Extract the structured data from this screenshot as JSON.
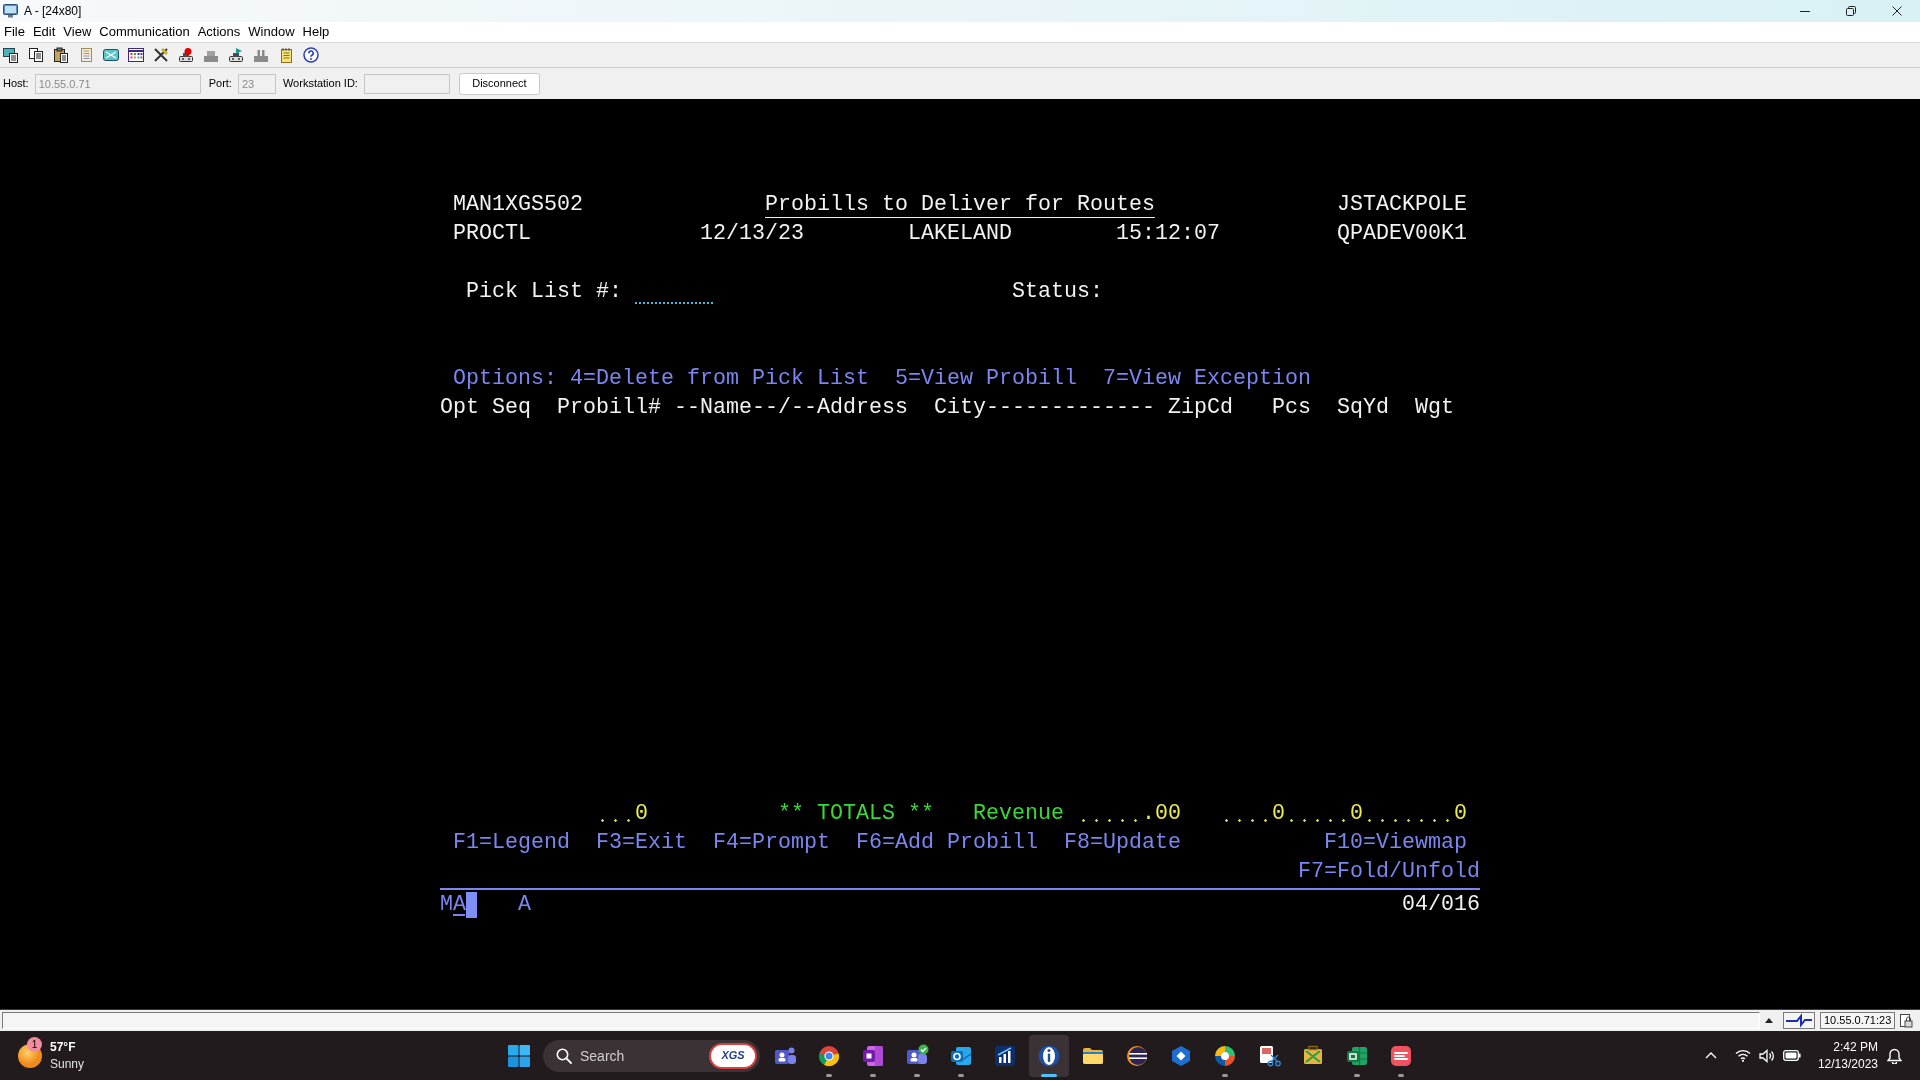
{
  "window": {
    "title": "A - [24x80]"
  },
  "menu": [
    "File",
    "Edit",
    "View",
    "Communication",
    "Actions",
    "Window",
    "Help"
  ],
  "connection": {
    "fields": [
      {
        "label": "Host:",
        "value": "10.55.0.71",
        "disabled": true
      },
      {
        "label": "Port:",
        "value": "23",
        "disabled": true
      },
      {
        "label": "Workstation ID:",
        "disabled": true
      }
    ],
    "button": "Disconnect"
  },
  "screen": {
    "header": {
      "program": "MAN1XGS502",
      "title": "Probills to Deliver for Routes",
      "user": "JSTACKPOLE"
    },
    "subheader": {
      "library": "PROCTL",
      "date": "12/13/23",
      "location": "LAKELAND",
      "time": "15:12:07",
      "device": "QPADEV00K1"
    },
    "pick_list": {
      "label": "Pick List #:"
    },
    "status": {
      "label": "Status:"
    },
    "options": {
      "label": "Options:",
      "items": [
        "4=Delete from Pick List",
        "5=View Probill",
        "7=View Exception"
      ]
    },
    "columns": [
      "Opt",
      "Seq",
      "Probill#",
      "--Name--/--Address",
      "City-------------",
      "ZipCd",
      "Pcs",
      "SqYd",
      "Wgt"
    ],
    "totals": {
      "count": "0",
      "label": "** TOTALS **",
      "revenue_label": "Revenue",
      "revenue": ".00",
      "pcs": "0",
      "sqyd": "0",
      "wgt": "0"
    },
    "function_keys": [
      "F1=Legend",
      "F3=Exit",
      "F4=Prompt",
      "F6=Add Probill",
      "F8=Update",
      "F10=Viewmap",
      "F7=Fold/Unfold"
    ]
  },
  "oia": {
    "indicator": "MA",
    "shift": "A",
    "cursor_position": "04/016"
  },
  "status_bar": {
    "address": "10.55.0.71:23"
  },
  "taskbar": {
    "weather": {
      "badge": "1",
      "temperature": "57°F",
      "condition": "Sunny"
    },
    "search": {
      "placeholder": "Search",
      "highlight": "XGS"
    },
    "apps": [
      {
        "kind": "people",
        "running": false,
        "selected": false
      },
      {
        "kind": "wheel",
        "running": true,
        "selected": false
      },
      {
        "kind": "notebook",
        "running": true,
        "selected": false
      },
      {
        "kind": "badge",
        "running": true,
        "selected": false
      },
      {
        "kind": "mail",
        "running": true,
        "selected": false
      },
      {
        "kind": "chart",
        "running": false,
        "selected": false
      },
      {
        "kind": "info",
        "running": true,
        "selected": true
      },
      {
        "kind": "folder",
        "running": false,
        "selected": false
      },
      {
        "kind": "globe",
        "running": false,
        "selected": false
      },
      {
        "kind": "hexagon",
        "running": false,
        "selected": false
      },
      {
        "kind": "swirl",
        "running": true,
        "selected": false
      },
      {
        "kind": "snip",
        "running": false,
        "selected": false
      },
      {
        "kind": "tools",
        "running": false,
        "selected": false
      },
      {
        "kind": "sheet",
        "running": true,
        "selected": false
      },
      {
        "kind": "stripes",
        "running": true,
        "selected": false
      }
    ],
    "clock": {
      "time": "2:42 PM",
      "date": "12/13/2023"
    }
  }
}
